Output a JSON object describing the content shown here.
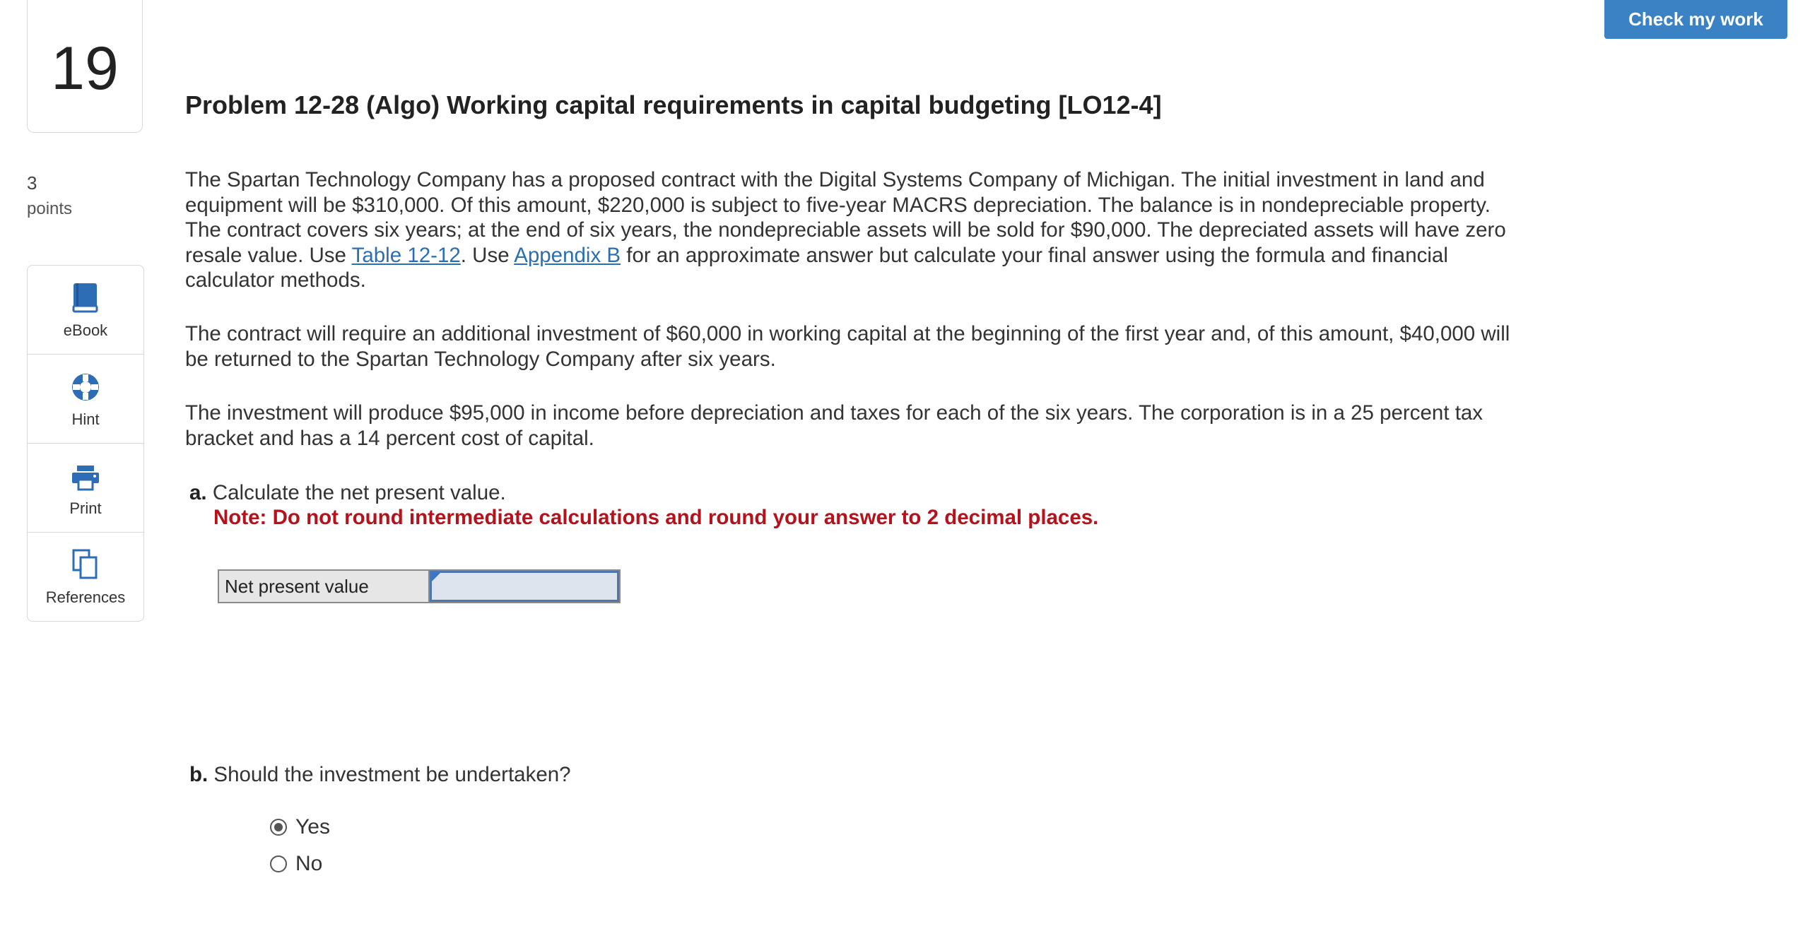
{
  "question": {
    "number": "19",
    "points_value": "3",
    "points_label": "points"
  },
  "tools": [
    {
      "label": "eBook",
      "icon": "book-icon"
    },
    {
      "label": "Hint",
      "icon": "lifebuoy-icon"
    },
    {
      "label": "Print",
      "icon": "printer-icon"
    },
    {
      "label": "References",
      "icon": "copy-documents-icon"
    }
  ],
  "header": {
    "check_button_label": "Check my work"
  },
  "problem": {
    "title": "Problem 12-28 (Algo) Working capital requirements in capital budgeting [LO12-4]",
    "p1_part1": "The Spartan Technology Company has a proposed contract with the Digital Systems Company of Michigan. The initial investment in land and equipment will be $310,000. Of this amount, $220,000 is subject to five-year MACRS depreciation. The balance is in nondepreciable property. The contract covers six years; at the end of six years, the nondepreciable assets will be sold for $90,000. The depreciated assets will have zero resale value. Use ",
    "link_table": "Table 12-12",
    "p1_part2": ". Use ",
    "link_appendix": "Appendix B",
    "p1_part3": " for an approximate answer but calculate your final answer using the formula and financial calculator methods.",
    "p2": "The contract will require an additional investment of $60,000 in working capital at the beginning of the first year and, of this amount, $40,000 will be returned to the Spartan Technology Company after six years.",
    "p3": "The investment will produce $95,000 in income before depreciation and taxes for each of the six years. The corporation is in a 25 percent tax bracket and has a 14 percent cost of capital."
  },
  "part_a": {
    "prefix": "a.",
    "question": "Calculate the net present value.",
    "note": "Note: Do not round intermediate calculations and round your answer to 2 decimal places.",
    "row_label": "Net present value",
    "input_value": ""
  },
  "part_b": {
    "prefix": "b.",
    "question": "Should the investment be undertaken?",
    "options": [
      {
        "label": "Yes",
        "selected": true
      },
      {
        "label": "No",
        "selected": false
      }
    ]
  },
  "colors": {
    "primary_button": "#3b82c4",
    "note_red": "#b5121b",
    "link_blue": "#2a6eb3",
    "tool_icon_blue": "#2d6db5"
  }
}
